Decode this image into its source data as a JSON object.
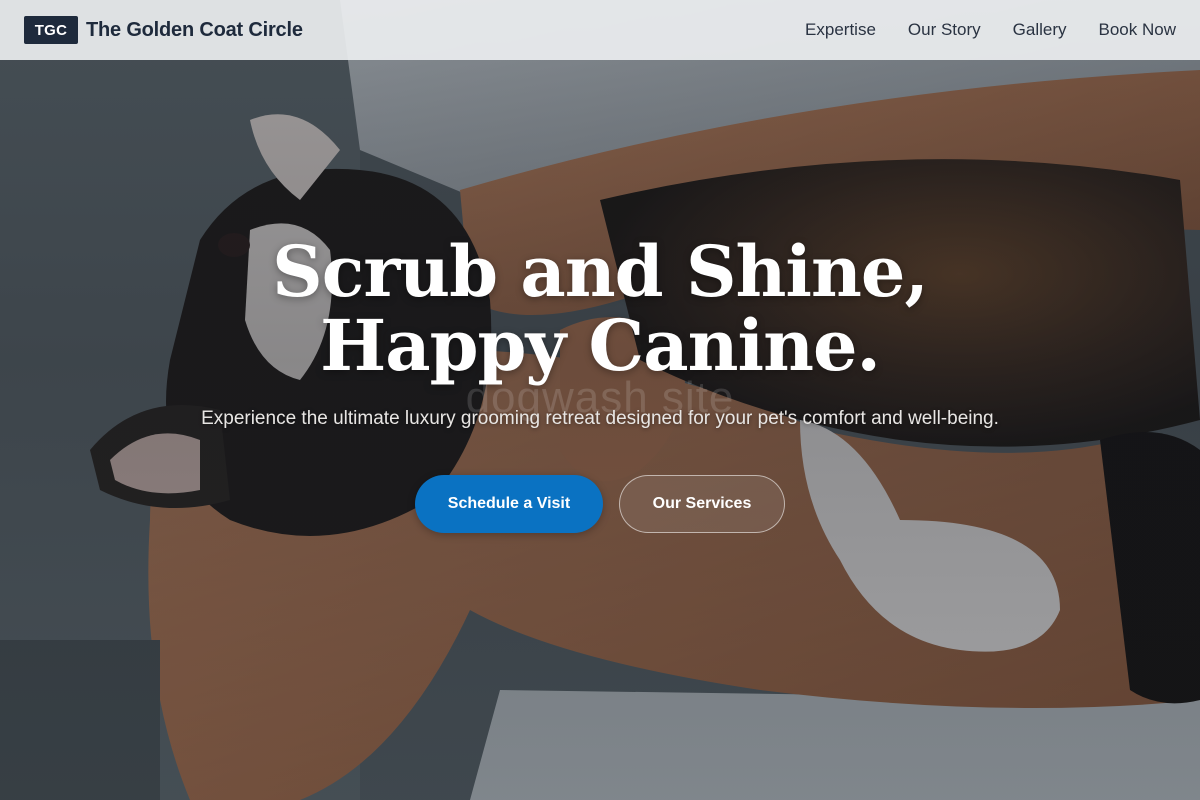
{
  "brand": {
    "badge": "TGC",
    "name": "The Golden Coat Circle"
  },
  "nav": {
    "links": [
      "Expertise",
      "Our Story",
      "Gallery",
      "Book Now"
    ]
  },
  "hero": {
    "headline_line1": "Scrub and Shine,",
    "headline_line2": "Happy Canine.",
    "subtitle": "Experience the ultimate luxury grooming retreat designed for your pet's comfort and well-being.",
    "watermark": "dogwash site",
    "primary_cta": "Schedule a Visit",
    "secondary_cta": "Our Services",
    "background_image": "cat-held-in-arms-photo"
  },
  "colors": {
    "brand_dark": "#1e2a3c",
    "accent_blue": "#0a72c2",
    "nav_bg": "#eceef0"
  }
}
